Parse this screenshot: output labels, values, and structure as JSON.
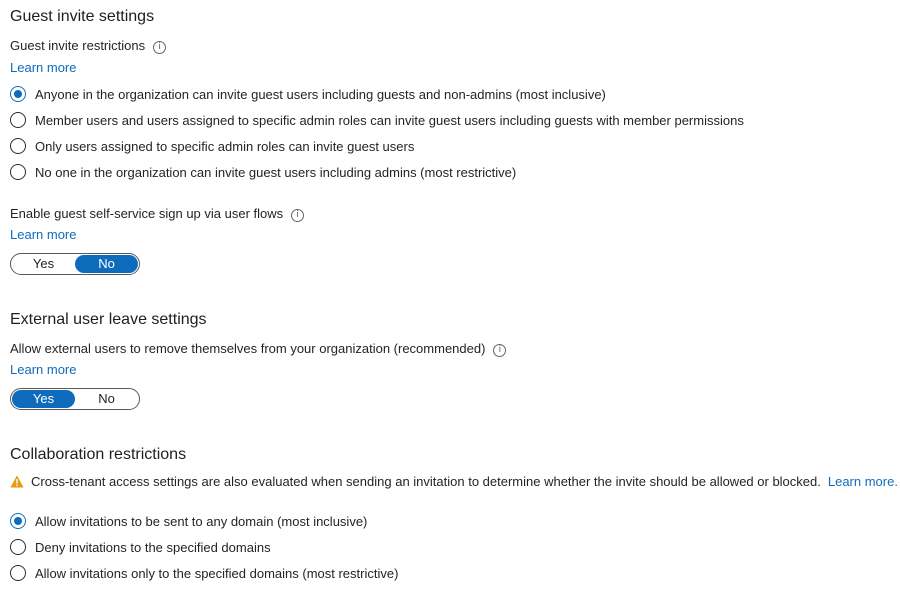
{
  "guest_invite": {
    "title": "Guest invite settings",
    "restrictions_label": "Guest invite restrictions",
    "learn_more": "Learn more",
    "options": [
      {
        "label": "Anyone in the organization can invite guest users including guests and non-admins (most inclusive)",
        "selected": true
      },
      {
        "label": "Member users and users assigned to specific admin roles can invite guest users including guests with member permissions",
        "selected": false
      },
      {
        "label": "Only users assigned to specific admin roles can invite guest users",
        "selected": false
      },
      {
        "label": "No one in the organization can invite guest users including admins (most restrictive)",
        "selected": false
      }
    ],
    "self_service_label": "Enable guest self-service sign up via user flows",
    "self_service_learn_more": "Learn more",
    "self_service_toggle": {
      "yes": "Yes",
      "no": "No",
      "value": "No"
    }
  },
  "external_leave": {
    "title": "External user leave settings",
    "allow_label": "Allow external users to remove themselves from your organization (recommended)",
    "learn_more": "Learn more",
    "toggle": {
      "yes": "Yes",
      "no": "No",
      "value": "Yes"
    }
  },
  "collaboration": {
    "title": "Collaboration restrictions",
    "warning_text": "Cross-tenant access settings are also evaluated when sending an invitation to determine whether the invite should be allowed or blocked.",
    "warning_link": "Learn more.",
    "options": [
      {
        "label": "Allow invitations to be sent to any domain (most inclusive)",
        "selected": true
      },
      {
        "label": "Deny invitations to the specified domains",
        "selected": false
      },
      {
        "label": "Allow invitations only to the specified domains (most restrictive)",
        "selected": false
      }
    ]
  },
  "colors": {
    "accent": "#0f6cbd",
    "warning": "#e39c0a"
  },
  "icons": {
    "info": "info-icon",
    "warning": "warning-icon"
  }
}
